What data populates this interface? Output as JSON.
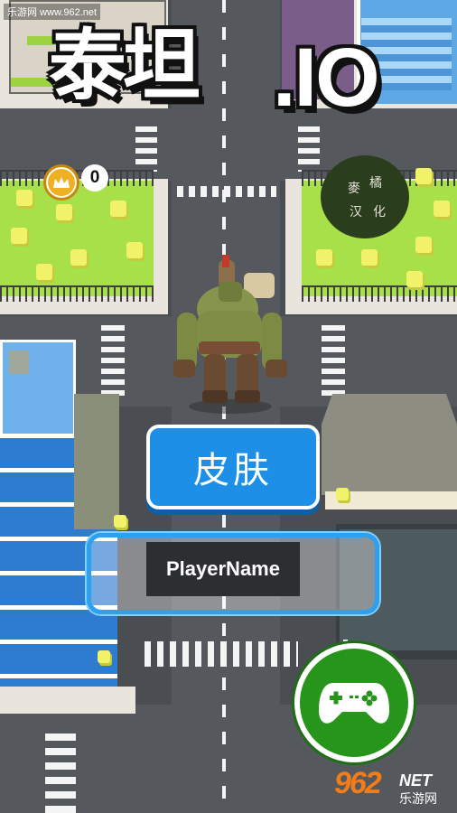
{
  "watermark": "乐游网 www.962.net",
  "title": {
    "main": "泰坦",
    "suffix": ".IO"
  },
  "coins": {
    "count": "0",
    "icon": "crown-coin-icon"
  },
  "seal": {
    "chars": [
      "麥",
      "橘",
      "汉",
      "化"
    ]
  },
  "skin_button": {
    "label": "皮肤"
  },
  "player_name": {
    "value": "PlayerName"
  },
  "play_button": {
    "icon": "gamepad-icon"
  },
  "site_logo": {
    "number": "962",
    "domain": "NET",
    "cn": "乐游网"
  },
  "colors": {
    "accent_blue": "#1d8fe6",
    "play_green": "#27941c",
    "coin_gold": "#f0b024",
    "park_green": "#a8e04a"
  }
}
